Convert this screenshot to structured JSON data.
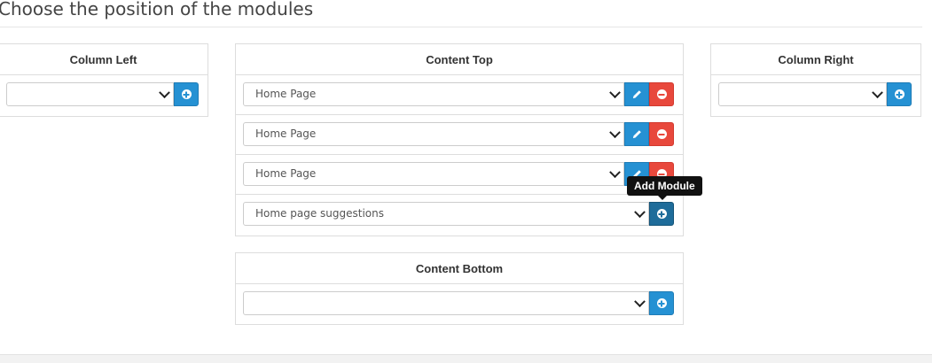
{
  "page": {
    "title": "Choose the position of the modules"
  },
  "tooltip": {
    "text": "Add Module"
  },
  "column_left": {
    "title": "Column Left",
    "add_row": {
      "value": ""
    }
  },
  "content_top": {
    "title": "Content Top",
    "rows": [
      {
        "value": "Home Page"
      },
      {
        "value": "Home Page"
      },
      {
        "value": "Home Page"
      }
    ],
    "add_row": {
      "value": "Home page suggestions"
    }
  },
  "column_right": {
    "title": "Column Right",
    "add_row": {
      "value": ""
    }
  },
  "content_bottom": {
    "title": "Content Bottom",
    "add_row": {
      "value": ""
    }
  },
  "icons": {
    "edit": "pencil-icon",
    "remove": "minus-circle-icon",
    "add": "plus-circle-icon",
    "dropdown": "chevron-down-icon"
  },
  "colors": {
    "primary": "#2591d3",
    "primary_active": "#1e6c9a",
    "danger": "#e8483c",
    "tooltip_bg": "#111111"
  }
}
